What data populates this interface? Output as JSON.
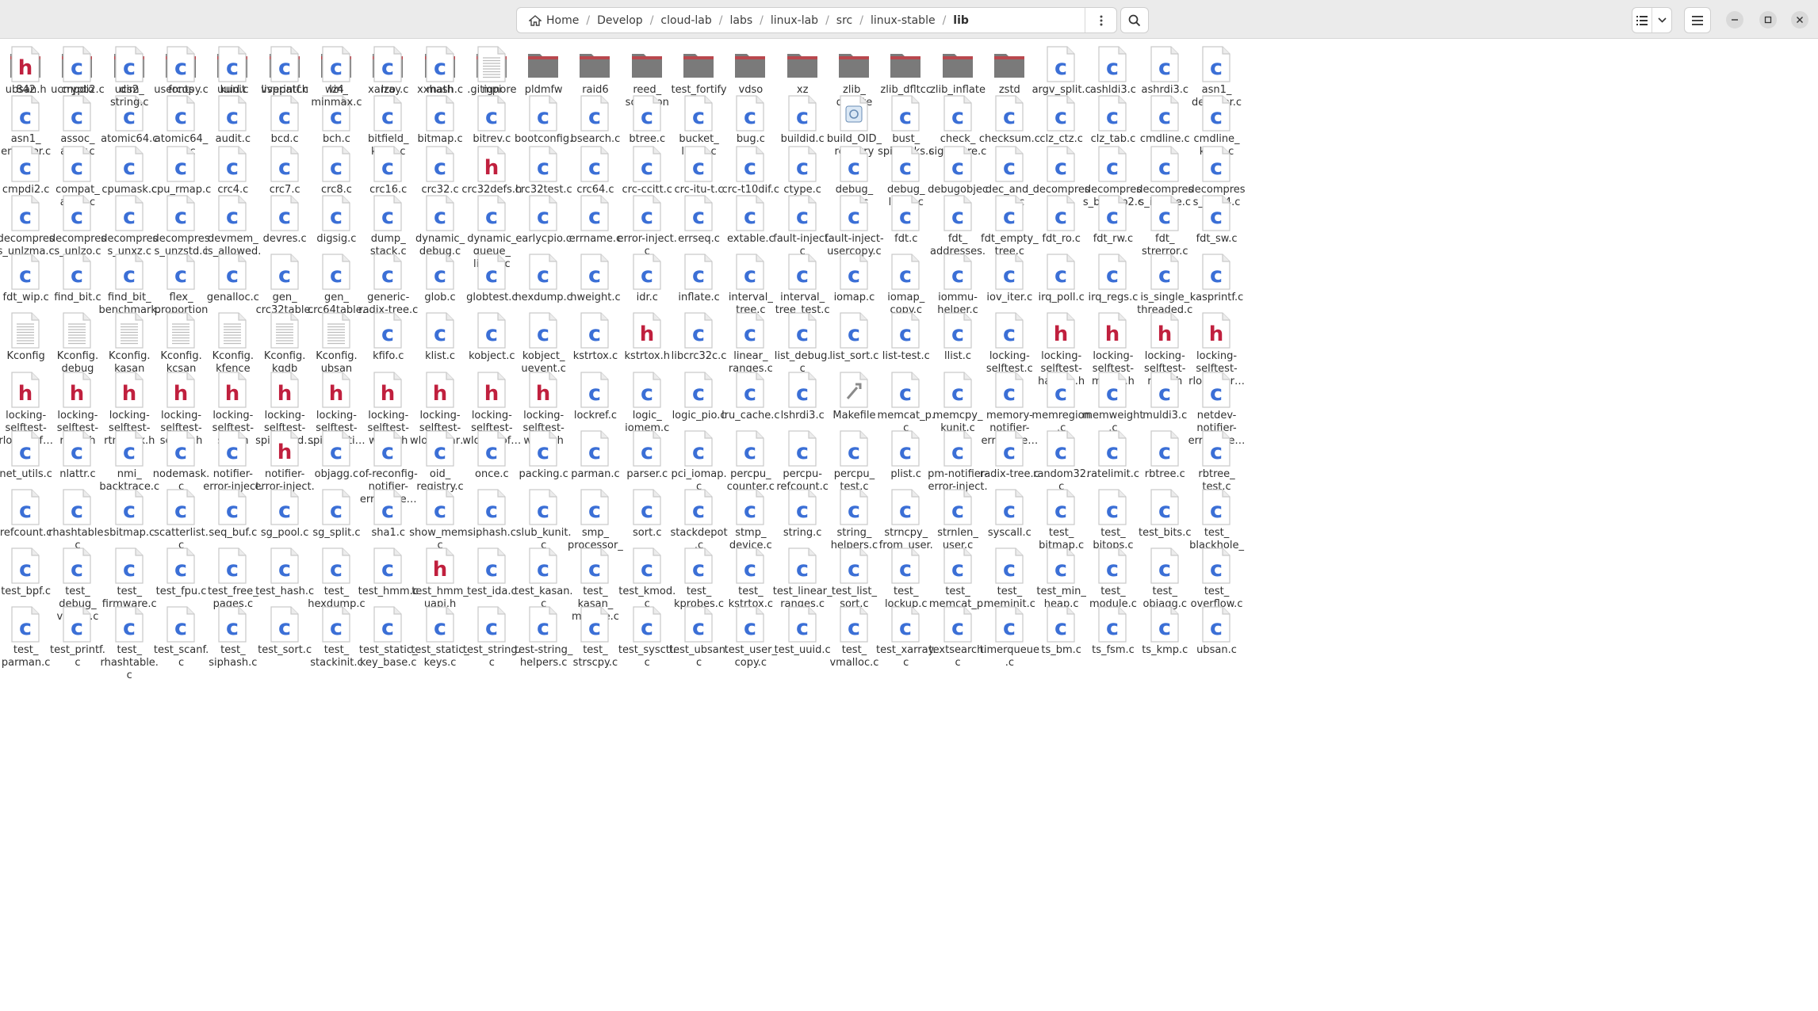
{
  "path": {
    "crumbs": [
      "Home",
      "Develop",
      "cloud-lab",
      "labs",
      "linux-lab",
      "src",
      "linux-stable",
      "lib"
    ]
  },
  "toolbar": {
    "path_menu_icon": "vertical-ellipsis-icon",
    "search_icon": "search-icon",
    "view_icon": "list-view-icon",
    "view_dropdown_icon": "chevron-down-icon",
    "main_menu_icon": "hamburger-menu-icon",
    "window_buttons": [
      "minimize-icon",
      "maximize-icon",
      "close-icon"
    ]
  },
  "colors": {
    "folder": "#7a7a7a",
    "folder_tab": "#b8484e",
    "c_letter": "#3b6fd6",
    "h_letter": "#c0203e",
    "doc_page": "#ffffff"
  },
  "files": [
    {
      "n": "842",
      "t": "d"
    },
    {
      "n": "crypto",
      "t": "d"
    },
    {
      "n": "dim",
      "t": "d"
    },
    {
      "n": "fonts",
      "t": "d"
    },
    {
      "n": "kunit",
      "t": "d"
    },
    {
      "n": "livepatch",
      "t": "d"
    },
    {
      "n": "lz4",
      "t": "d"
    },
    {
      "n": "lzo",
      "t": "d"
    },
    {
      "n": "math",
      "t": "d"
    },
    {
      "n": "mpi",
      "t": "d"
    },
    {
      "n": "pldmfw",
      "t": "d"
    },
    {
      "n": "raid6",
      "t": "d"
    },
    {
      "n": "reed_\nsolomon",
      "t": "d"
    },
    {
      "n": "test_fortify",
      "t": "d"
    },
    {
      "n": "vdso",
      "t": "d"
    },
    {
      "n": "xz",
      "t": "d"
    },
    {
      "n": "zlib_\ndeflate",
      "t": "d"
    },
    {
      "n": "zlib_dfltcc",
      "t": "d"
    },
    {
      "n": "zlib_inflate",
      "t": "d"
    },
    {
      "n": "zstd",
      "t": "d"
    },
    {
      "n": "argv_split.c",
      "t": "c"
    },
    {
      "n": "ashldi3.c",
      "t": "c"
    },
    {
      "n": "ashrdi3.c",
      "t": "c"
    },
    {
      "n": "asn1_\ndecoder.c",
      "t": "c"
    },
    {
      "n": "asn1_\nencoder.c",
      "t": "c"
    },
    {
      "n": "assoc_\narray.c",
      "t": "c"
    },
    {
      "n": "atomic64.c",
      "t": "c"
    },
    {
      "n": "atomic64_\ntest.c",
      "t": "c"
    },
    {
      "n": "audit.c",
      "t": "c"
    },
    {
      "n": "bcd.c",
      "t": "c"
    },
    {
      "n": "bch.c",
      "t": "c"
    },
    {
      "n": "bitfield_\nkunit.c",
      "t": "c"
    },
    {
      "n": "bitmap.c",
      "t": "c"
    },
    {
      "n": "bitrev.c",
      "t": "c"
    },
    {
      "n": "bootconfig.\nc",
      "t": "c"
    },
    {
      "n": "bsearch.c",
      "t": "c"
    },
    {
      "n": "btree.c",
      "t": "c"
    },
    {
      "n": "bucket_\nlocks.c",
      "t": "c"
    },
    {
      "n": "bug.c",
      "t": "c"
    },
    {
      "n": "buildid.c",
      "t": "c"
    },
    {
      "n": "build_OID_\nregistry",
      "t": "x"
    },
    {
      "n": "bust_\nspinlocks.c",
      "t": "c"
    },
    {
      "n": "check_\nsignature.c",
      "t": "c"
    },
    {
      "n": "checksum.c",
      "t": "c"
    },
    {
      "n": "clz_ctz.c",
      "t": "c"
    },
    {
      "n": "clz_tab.c",
      "t": "c"
    },
    {
      "n": "cmdline.c",
      "t": "c"
    },
    {
      "n": "cmdline_\nkunit.c",
      "t": "c"
    },
    {
      "n": "cmpdi2.c",
      "t": "c"
    },
    {
      "n": "compat_\naudit.c",
      "t": "c"
    },
    {
      "n": "cpumask.c",
      "t": "c"
    },
    {
      "n": "cpu_rmap.c",
      "t": "c"
    },
    {
      "n": "crc4.c",
      "t": "c"
    },
    {
      "n": "crc7.c",
      "t": "c"
    },
    {
      "n": "crc8.c",
      "t": "c"
    },
    {
      "n": "crc16.c",
      "t": "c"
    },
    {
      "n": "crc32.c",
      "t": "c"
    },
    {
      "n": "crc32defs.h",
      "t": "h"
    },
    {
      "n": "crc32test.c",
      "t": "c"
    },
    {
      "n": "crc64.c",
      "t": "c"
    },
    {
      "n": "crc-ccitt.c",
      "t": "c"
    },
    {
      "n": "crc-itu-t.c",
      "t": "c"
    },
    {
      "n": "crc-t10dif.c",
      "t": "c"
    },
    {
      "n": "ctype.c",
      "t": "c"
    },
    {
      "n": "debug_\ninfo.c",
      "t": "c"
    },
    {
      "n": "debug_\nlocks.c",
      "t": "c"
    },
    {
      "n": "debugobjec\nts.c",
      "t": "c"
    },
    {
      "n": "dec_and_\nlock.c",
      "t": "c"
    },
    {
      "n": "decompres\ns.c",
      "t": "c"
    },
    {
      "n": "decompres\ns_bunzip2.c",
      "t": "c"
    },
    {
      "n": "decompres\ns_inflate.c",
      "t": "c"
    },
    {
      "n": "decompres\ns_unlz4.c",
      "t": "c"
    },
    {
      "n": "decompres\ns_unlzma.c",
      "t": "c"
    },
    {
      "n": "decompres\ns_unlzo.c",
      "t": "c"
    },
    {
      "n": "decompres\ns_unxz.c",
      "t": "c"
    },
    {
      "n": "decompres\ns_unzstd.c",
      "t": "c"
    },
    {
      "n": "devmem_\nis_allowed.\nc",
      "t": "c"
    },
    {
      "n": "devres.c",
      "t": "c"
    },
    {
      "n": "digsig.c",
      "t": "c"
    },
    {
      "n": "dump_\nstack.c",
      "t": "c"
    },
    {
      "n": "dynamic_\ndebug.c",
      "t": "c"
    },
    {
      "n": "dynamic_\nqueue_\nlimits.c",
      "t": "c"
    },
    {
      "n": "earlycpio.c",
      "t": "c"
    },
    {
      "n": "errname.c",
      "t": "c"
    },
    {
      "n": "error-inject.\nc",
      "t": "c"
    },
    {
      "n": "errseq.c",
      "t": "c"
    },
    {
      "n": "extable.c",
      "t": "c"
    },
    {
      "n": "fault-inject.\nc",
      "t": "c"
    },
    {
      "n": "fault-inject-\nusercopy.c",
      "t": "c"
    },
    {
      "n": "fdt.c",
      "t": "c"
    },
    {
      "n": "fdt_\naddresses.\nc",
      "t": "c"
    },
    {
      "n": "fdt_empty_\ntree.c",
      "t": "c"
    },
    {
      "n": "fdt_ro.c",
      "t": "c"
    },
    {
      "n": "fdt_rw.c",
      "t": "c"
    },
    {
      "n": "fdt_\nstrerror.c",
      "t": "c"
    },
    {
      "n": "fdt_sw.c",
      "t": "c"
    },
    {
      "n": "fdt_wip.c",
      "t": "c"
    },
    {
      "n": "find_bit.c",
      "t": "c"
    },
    {
      "n": "find_bit_\nbenchmark.\nc",
      "t": "c"
    },
    {
      "n": "flex_\nproportion\ns.c",
      "t": "c"
    },
    {
      "n": "genalloc.c",
      "t": "c"
    },
    {
      "n": "gen_\ncrc32table.\nc",
      "t": "c"
    },
    {
      "n": "gen_\ncrc64table.\nc",
      "t": "c"
    },
    {
      "n": "generic-\nradix-tree.c",
      "t": "c"
    },
    {
      "n": "glob.c",
      "t": "c"
    },
    {
      "n": "globtest.c",
      "t": "c"
    },
    {
      "n": "hexdump.c",
      "t": "c"
    },
    {
      "n": "hweight.c",
      "t": "c"
    },
    {
      "n": "idr.c",
      "t": "c"
    },
    {
      "n": "inflate.c",
      "t": "c"
    },
    {
      "n": "interval_\ntree.c",
      "t": "c"
    },
    {
      "n": "interval_\ntree_test.c",
      "t": "c"
    },
    {
      "n": "iomap.c",
      "t": "c"
    },
    {
      "n": "iomap_\ncopy.c",
      "t": "c"
    },
    {
      "n": "iommu-\nhelper.c",
      "t": "c"
    },
    {
      "n": "iov_iter.c",
      "t": "c"
    },
    {
      "n": "irq_poll.c",
      "t": "c"
    },
    {
      "n": "irq_regs.c",
      "t": "c"
    },
    {
      "n": "is_single_\nthreaded.c",
      "t": "c"
    },
    {
      "n": "kasprintf.c",
      "t": "c"
    },
    {
      "n": "Kconfig",
      "t": "t"
    },
    {
      "n": "Kconfig.\ndebug",
      "t": "t"
    },
    {
      "n": "Kconfig.\nkasan",
      "t": "t"
    },
    {
      "n": "Kconfig.\nkcsan",
      "t": "t"
    },
    {
      "n": "Kconfig.\nkfence",
      "t": "t"
    },
    {
      "n": "Kconfig.\nkgdb",
      "t": "t"
    },
    {
      "n": "Kconfig.\nubsan",
      "t": "t"
    },
    {
      "n": "kfifo.c",
      "t": "c"
    },
    {
      "n": "klist.c",
      "t": "c"
    },
    {
      "n": "kobject.c",
      "t": "c"
    },
    {
      "n": "kobject_\nuevent.c",
      "t": "c"
    },
    {
      "n": "kstrtox.c",
      "t": "c"
    },
    {
      "n": "kstrtox.h",
      "t": "h"
    },
    {
      "n": "libcrc32c.c",
      "t": "c"
    },
    {
      "n": "linear_\nranges.c",
      "t": "c"
    },
    {
      "n": "list_debug.\nc",
      "t": "c"
    },
    {
      "n": "list_sort.c",
      "t": "c"
    },
    {
      "n": "list-test.c",
      "t": "c"
    },
    {
      "n": "llist.c",
      "t": "c"
    },
    {
      "n": "locking-\nselftest.c",
      "t": "c"
    },
    {
      "n": "locking-\nselftest-\nhardirq.h",
      "t": "h"
    },
    {
      "n": "locking-\nselftest-\nmutex.h",
      "t": "h"
    },
    {
      "n": "locking-\nselftest-\nrlock.h",
      "t": "h"
    },
    {
      "n": "locking-\nselftest-\nrlock-har…",
      "t": "h"
    },
    {
      "n": "locking-\nselftest-\nrlock-sof…",
      "t": "h"
    },
    {
      "n": "locking-\nselftest-\nrsem.h",
      "t": "h"
    },
    {
      "n": "locking-\nselftest-\nrtmutex.h",
      "t": "h"
    },
    {
      "n": "locking-\nselftest-\nsoftirq.h",
      "t": "h"
    },
    {
      "n": "locking-\nselftest-\nspin.h",
      "t": "h"
    },
    {
      "n": "locking-\nselftest-\nspin-hard…",
      "t": "h"
    },
    {
      "n": "locking-\nselftest-\nspin-softi…",
      "t": "h"
    },
    {
      "n": "locking-\nselftest-\nwlock.h",
      "t": "h"
    },
    {
      "n": "locking-\nselftest-\nwlock-har…",
      "t": "h"
    },
    {
      "n": "locking-\nselftest-\nwlock-sof…",
      "t": "h"
    },
    {
      "n": "locking-\nselftest-\nwsem.h",
      "t": "h"
    },
    {
      "n": "lockref.c",
      "t": "c"
    },
    {
      "n": "logic_\niomem.c",
      "t": "c"
    },
    {
      "n": "logic_pio.c",
      "t": "c"
    },
    {
      "n": "lru_cache.c",
      "t": "c"
    },
    {
      "n": "lshrdi3.c",
      "t": "c"
    },
    {
      "n": "Makefile",
      "t": "m"
    },
    {
      "n": "memcat_p.\nc",
      "t": "c"
    },
    {
      "n": "memcpy_\nkunit.c",
      "t": "c"
    },
    {
      "n": "memory-\nnotifier-\nerror-inje…",
      "t": "c"
    },
    {
      "n": "memregion\n.c",
      "t": "c"
    },
    {
      "n": "memweight\n.c",
      "t": "c"
    },
    {
      "n": "muldi3.c",
      "t": "c"
    },
    {
      "n": "netdev-\nnotifier-\nerror-inje…",
      "t": "c"
    },
    {
      "n": "net_utils.c",
      "t": "c"
    },
    {
      "n": "nlattr.c",
      "t": "c"
    },
    {
      "n": "nmi_\nbacktrace.c",
      "t": "c"
    },
    {
      "n": "nodemask.\nc",
      "t": "c"
    },
    {
      "n": "notifier-\nerror-inject.\nc",
      "t": "c"
    },
    {
      "n": "notifier-\nerror-inject.\nh",
      "t": "h"
    },
    {
      "n": "objagg.c",
      "t": "c"
    },
    {
      "n": "of-reconfig-\nnotifier-\nerror-inje…",
      "t": "c"
    },
    {
      "n": "oid_\nregistry.c",
      "t": "c"
    },
    {
      "n": "once.c",
      "t": "c"
    },
    {
      "n": "packing.c",
      "t": "c"
    },
    {
      "n": "parman.c",
      "t": "c"
    },
    {
      "n": "parser.c",
      "t": "c"
    },
    {
      "n": "pci_iomap.\nc",
      "t": "c"
    },
    {
      "n": "percpu_\ncounter.c",
      "t": "c"
    },
    {
      "n": "percpu-\nrefcount.c",
      "t": "c"
    },
    {
      "n": "percpu_\ntest.c",
      "t": "c"
    },
    {
      "n": "plist.c",
      "t": "c"
    },
    {
      "n": "pm-notifier-\nerror-inject.\nc",
      "t": "c"
    },
    {
      "n": "radix-tree.c",
      "t": "c"
    },
    {
      "n": "random32.\nc",
      "t": "c"
    },
    {
      "n": "ratelimit.c",
      "t": "c"
    },
    {
      "n": "rbtree.c",
      "t": "c"
    },
    {
      "n": "rbtree_\ntest.c",
      "t": "c"
    },
    {
      "n": "refcount.c",
      "t": "c"
    },
    {
      "n": "rhashtable.\nc",
      "t": "c"
    },
    {
      "n": "sbitmap.c",
      "t": "c"
    },
    {
      "n": "scatterlist.\nc",
      "t": "c"
    },
    {
      "n": "seq_buf.c",
      "t": "c"
    },
    {
      "n": "sg_pool.c",
      "t": "c"
    },
    {
      "n": "sg_split.c",
      "t": "c"
    },
    {
      "n": "sha1.c",
      "t": "c"
    },
    {
      "n": "show_mem.\nc",
      "t": "c"
    },
    {
      "n": "siphash.c",
      "t": "c"
    },
    {
      "n": "slub_kunit.\nc",
      "t": "c"
    },
    {
      "n": "smp_\nprocessor_\nid.c",
      "t": "c"
    },
    {
      "n": "sort.c",
      "t": "c"
    },
    {
      "n": "stackdepot\n.c",
      "t": "c"
    },
    {
      "n": "stmp_\ndevice.c",
      "t": "c"
    },
    {
      "n": "string.c",
      "t": "c"
    },
    {
      "n": "string_\nhelpers.c",
      "t": "c"
    },
    {
      "n": "strncpy_\nfrom_user.\nc",
      "t": "c"
    },
    {
      "n": "strnlen_\nuser.c",
      "t": "c"
    },
    {
      "n": "syscall.c",
      "t": "c"
    },
    {
      "n": "test_\nbitmap.c",
      "t": "c"
    },
    {
      "n": "test_\nbitops.c",
      "t": "c"
    },
    {
      "n": "test_bits.c",
      "t": "c"
    },
    {
      "n": "test_\nblackhole_\ndev.c",
      "t": "c"
    },
    {
      "n": "test_bpf.c",
      "t": "c"
    },
    {
      "n": "test_\ndebug_\nvirtual.c",
      "t": "c"
    },
    {
      "n": "test_\nfirmware.c",
      "t": "c"
    },
    {
      "n": "test_fpu.c",
      "t": "c"
    },
    {
      "n": "test_free_\npages.c",
      "t": "c"
    },
    {
      "n": "test_hash.c",
      "t": "c"
    },
    {
      "n": "test_\nhexdump.c",
      "t": "c"
    },
    {
      "n": "test_hmm.c",
      "t": "c"
    },
    {
      "n": "test_hmm_\nuapi.h",
      "t": "h"
    },
    {
      "n": "test_ida.c",
      "t": "c"
    },
    {
      "n": "test_kasan.\nc",
      "t": "c"
    },
    {
      "n": "test_\nkasan_\nmodule.c",
      "t": "c"
    },
    {
      "n": "test_kmod.\nc",
      "t": "c"
    },
    {
      "n": "test_\nkprobes.c",
      "t": "c"
    },
    {
      "n": "test_\nkstrtox.c",
      "t": "c"
    },
    {
      "n": "test_linear_\nranges.c",
      "t": "c"
    },
    {
      "n": "test_list_\nsort.c",
      "t": "c"
    },
    {
      "n": "test_\nlockup.c",
      "t": "c"
    },
    {
      "n": "test_\nmemcat_p.\nc",
      "t": "c"
    },
    {
      "n": "test_\nmeminit.c",
      "t": "c"
    },
    {
      "n": "test_min_\nheap.c",
      "t": "c"
    },
    {
      "n": "test_\nmodule.c",
      "t": "c"
    },
    {
      "n": "test_\nobjagg.c",
      "t": "c"
    },
    {
      "n": "test_\noverflow.c",
      "t": "c"
    },
    {
      "n": "test_\nparman.c",
      "t": "c"
    },
    {
      "n": "test_printf.\nc",
      "t": "c"
    },
    {
      "n": "test_\nrhashtable.\nc",
      "t": "c"
    },
    {
      "n": "test_scanf.\nc",
      "t": "c"
    },
    {
      "n": "test_\nsiphash.c",
      "t": "c"
    },
    {
      "n": "test_sort.c",
      "t": "c"
    },
    {
      "n": "test_\nstackinit.c",
      "t": "c"
    },
    {
      "n": "test_static_\nkey_base.c",
      "t": "c"
    },
    {
      "n": "test_static_\nkeys.c",
      "t": "c"
    },
    {
      "n": "test_string.\nc",
      "t": "c"
    },
    {
      "n": "test-string_\nhelpers.c",
      "t": "c"
    },
    {
      "n": "test_\nstrscpy.c",
      "t": "c"
    },
    {
      "n": "test_sysctl.\nc",
      "t": "c"
    },
    {
      "n": "test_ubsan.\nc",
      "t": "c"
    },
    {
      "n": "test_user_\ncopy.c",
      "t": "c"
    },
    {
      "n": "test_uuid.c",
      "t": "c"
    },
    {
      "n": "test_\nvmalloc.c",
      "t": "c"
    },
    {
      "n": "test_xarray.\nc",
      "t": "c"
    },
    {
      "n": "textsearch.\nc",
      "t": "c"
    },
    {
      "n": "timerqueue\n.c",
      "t": "c"
    },
    {
      "n": "ts_bm.c",
      "t": "c"
    },
    {
      "n": "ts_fsm.c",
      "t": "c"
    },
    {
      "n": "ts_kmp.c",
      "t": "c"
    },
    {
      "n": "ubsan.c",
      "t": "c"
    },
    {
      "n": "ubsan.h",
      "t": "h"
    },
    {
      "n": "ucmpdi2.c",
      "t": "c"
    },
    {
      "n": "ucs2_\nstring.c",
      "t": "c"
    },
    {
      "n": "usercopy.c",
      "t": "c"
    },
    {
      "n": "uuid.c",
      "t": "c"
    },
    {
      "n": "vsprintf.c",
      "t": "c"
    },
    {
      "n": "win_\nminmax.c",
      "t": "c"
    },
    {
      "n": "xarray.c",
      "t": "c"
    },
    {
      "n": "xxhash.c",
      "t": "c"
    },
    {
      "n": ".gitignore",
      "t": "t"
    }
  ]
}
